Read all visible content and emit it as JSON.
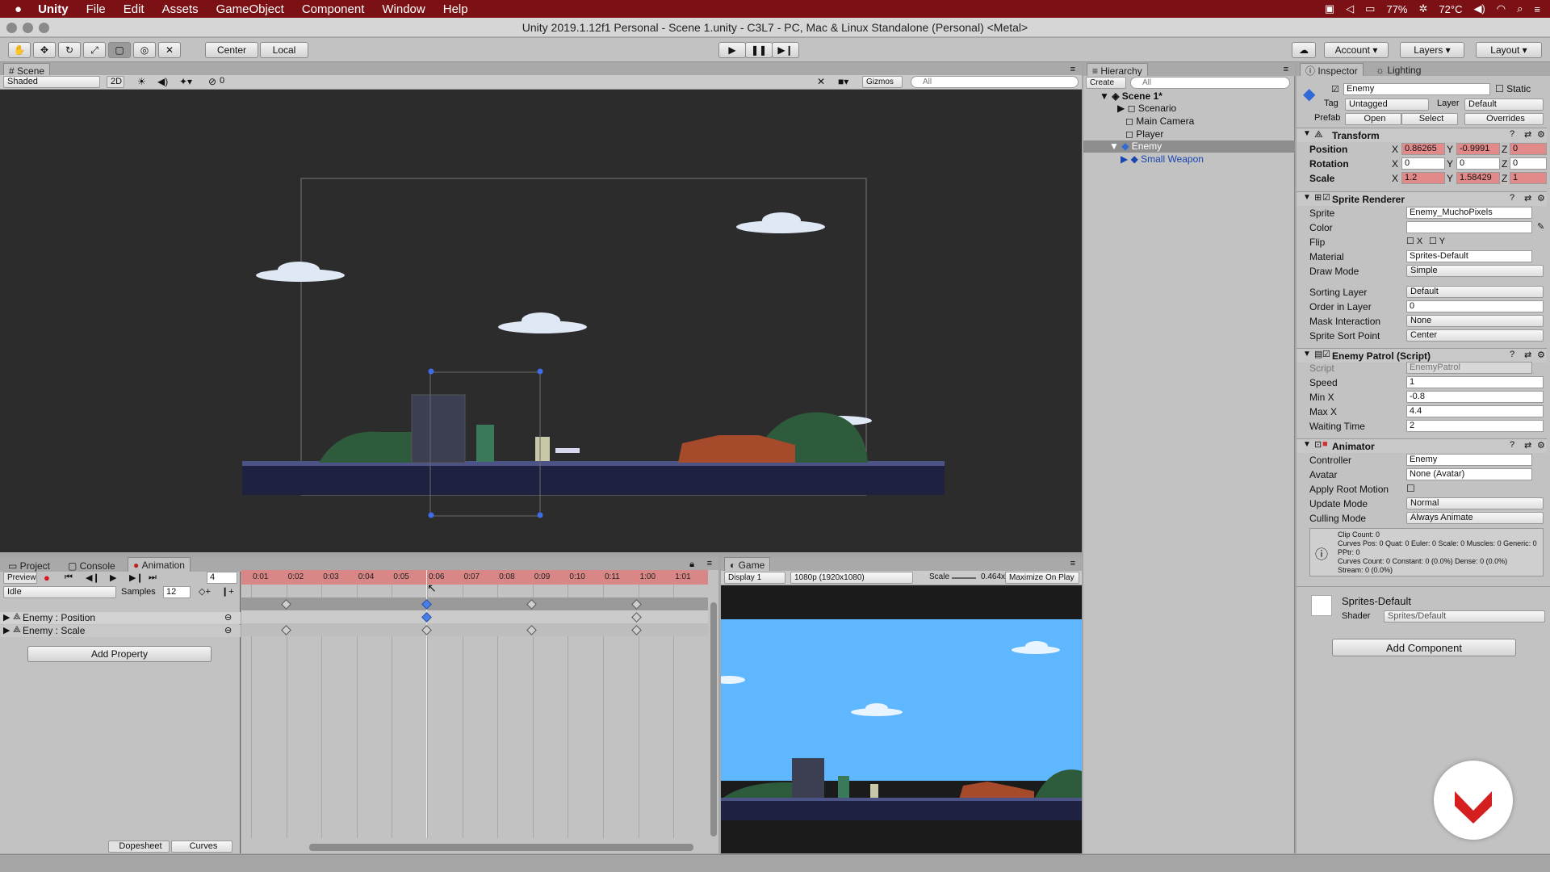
{
  "menubar": {
    "apple": "",
    "app": "Unity",
    "items": [
      "File",
      "Edit",
      "Assets",
      "GameObject",
      "Component",
      "Window",
      "Help"
    ],
    "status": {
      "battery": "77%",
      "temp": "72°C"
    }
  },
  "window_title": "Unity 2019.1.12f1 Personal - Scene 1.unity - C3L7 - PC, Mac & Linux Standalone (Personal) <Metal>",
  "toolbar": {
    "center": "Center",
    "local": "Local",
    "account": "Account",
    "layers": "Layers",
    "layout": "Layout"
  },
  "scene": {
    "tab": "Scene",
    "shading": "Shaded",
    "mode2d": "2D",
    "fx_count": "0",
    "gizmos": "Gizmos",
    "search_placeholder": "All"
  },
  "hierarchy": {
    "tab": "Hierarchy",
    "create": "Create",
    "search_placeholder": "All",
    "scene": "Scene 1*",
    "items": [
      "Scenario",
      "Main Camera",
      "Player",
      "Enemy",
      "Small Weapon"
    ]
  },
  "inspector": {
    "tab": "Inspector",
    "lighting_tab": "Lighting",
    "name": "Enemy",
    "static": "Static",
    "tag_label": "Tag",
    "tag": "Untagged",
    "layer_label": "Layer",
    "layer": "Default",
    "prefab_label": "Prefab",
    "open": "Open",
    "select": "Select",
    "overrides": "Overrides",
    "transform": {
      "title": "Transform",
      "position": "Position",
      "rotation": "Rotation",
      "scale": "Scale",
      "px": "0.86265",
      "py": "-0.9991",
      "pz": "0",
      "rx": "0",
      "ry": "0",
      "rz": "0",
      "sx": "1.2",
      "sy": "1.58429",
      "sz": "1"
    },
    "sprite_renderer": {
      "title": "Sprite Renderer",
      "sprite_label": "Sprite",
      "sprite": "Enemy_MuchoPixels",
      "color_label": "Color",
      "flip_label": "Flip",
      "flip_x": "X",
      "flip_y": "Y",
      "material_label": "Material",
      "material": "Sprites-Default",
      "draw_mode_label": "Draw Mode",
      "draw_mode": "Simple",
      "sorting_layer_label": "Sorting Layer",
      "sorting_layer": "Default",
      "order_label": "Order in Layer",
      "order": "0",
      "mask_label": "Mask Interaction",
      "mask": "None",
      "sort_point_label": "Sprite Sort Point",
      "sort_point": "Center"
    },
    "enemy_patrol": {
      "title": "Enemy Patrol (Script)",
      "script_label": "Script",
      "script": "EnemyPatrol",
      "speed_label": "Speed",
      "speed": "1",
      "minx_label": "Min X",
      "minx": "-0.8",
      "maxx_label": "Max X",
      "maxx": "4.4",
      "wait_label": "Waiting Time",
      "wait": "2"
    },
    "animator": {
      "title": "Animator",
      "controller_label": "Controller",
      "controller": "Enemy",
      "avatar_label": "Avatar",
      "avatar": "None (Avatar)",
      "root_label": "Apply Root Motion",
      "update_label": "Update Mode",
      "update": "Normal",
      "culling_label": "Culling Mode",
      "culling": "Always Animate",
      "info": [
        "Clip Count: 0",
        "Curves Pos: 0 Quat: 0 Euler: 0 Scale: 0 Muscles: 0 Generic: 0 PPtr: 0",
        "Curves Count: 0 Constant: 0 (0.0%) Dense: 0 (0.0%)",
        "Stream: 0 (0.0%)"
      ]
    },
    "material": {
      "name": "Sprites-Default",
      "shader_label": "Shader",
      "shader": "Sprites/Default"
    },
    "add_component": "Add Component"
  },
  "animation": {
    "tabs": [
      "Project",
      "Console",
      "Animation"
    ],
    "preview": "Preview",
    "frame": "4",
    "clip": "Idle",
    "samples_label": "Samples",
    "samples": "12",
    "ticks": [
      "0:01",
      "0:02",
      "0:03",
      "0:04",
      "0:05",
      "0:06",
      "0:07",
      "0:08",
      "0:09",
      "0:10",
      "0:11",
      "1:00",
      "1:01"
    ],
    "properties": [
      "Enemy : Position",
      "Enemy : Scale"
    ],
    "add_property": "Add Property",
    "dopesheet": "Dopesheet",
    "curves": "Curves"
  },
  "game": {
    "tab": "Game",
    "display": "Display 1",
    "resolution": "1080p (1920x1080)",
    "scale_label": "Scale",
    "scale": "0.464x",
    "maximize": "Maximize On Play"
  }
}
